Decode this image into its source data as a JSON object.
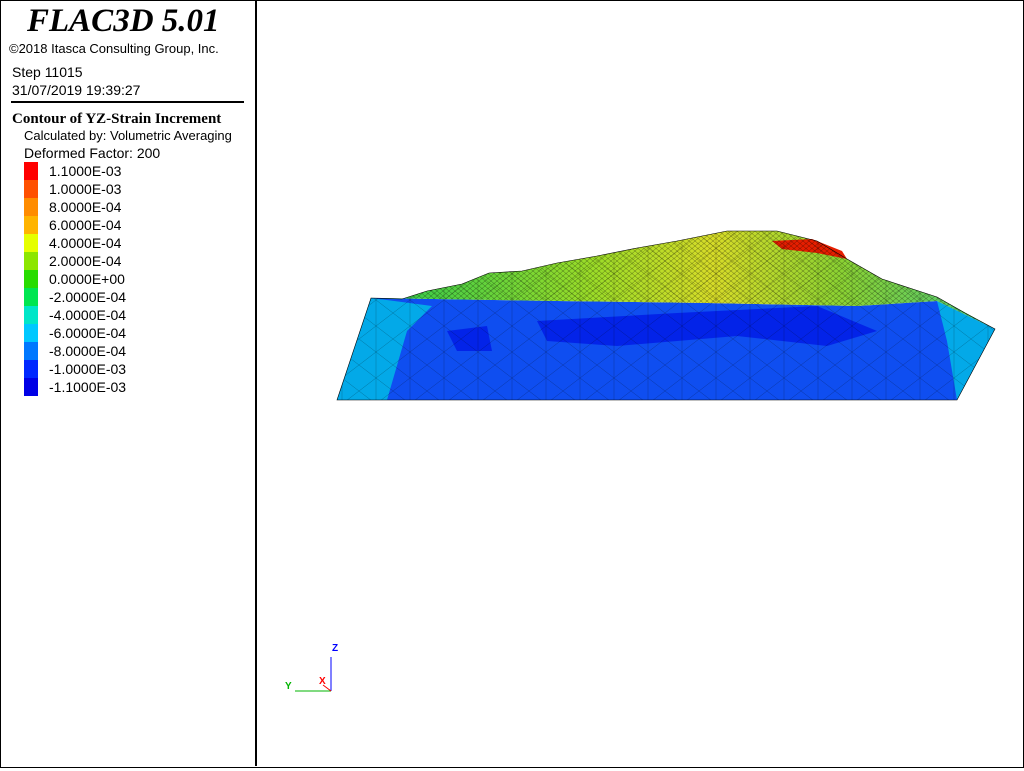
{
  "header": {
    "app_title": "FLAC3D 5.01",
    "copyright": "©2018 Itasca Consulting Group, Inc.",
    "step": "Step 11015",
    "timestamp": "31/07/2019 19:39:27"
  },
  "contour": {
    "title": "Contour of YZ-Strain Increment",
    "calculated_by": "Calculated by: Volumetric Averaging",
    "deformed_factor": "Deformed Factor: 200",
    "scale": [
      {
        "label": "1.1000E-03",
        "color": "#ff0000"
      },
      {
        "label": "1.0000E-03",
        "color": "#ff5000"
      },
      {
        "label": "8.0000E-04",
        "color": "#ff8c00"
      },
      {
        "label": "6.0000E-04",
        "color": "#ffb400"
      },
      {
        "label": "4.0000E-04",
        "color": "#e6ff00"
      },
      {
        "label": "2.0000E-04",
        "color": "#8ce600"
      },
      {
        "label": "0.0000E+00",
        "color": "#28dc00"
      },
      {
        "label": "-2.0000E-04",
        "color": "#00e650"
      },
      {
        "label": "-4.0000E-04",
        "color": "#00e6c8"
      },
      {
        "label": "-6.0000E-04",
        "color": "#00c8ff"
      },
      {
        "label": "-8.0000E-04",
        "color": "#0078ff"
      },
      {
        "label": "-1.0000E-03",
        "color": "#0028ff"
      },
      {
        "label": "-1.1000E-03",
        "color": "#0000e6"
      }
    ]
  },
  "axes": {
    "z_label": "Z",
    "y_label": "Y",
    "x_label": "X",
    "z_color": "#0000ff",
    "y_color": "#00b400",
    "x_color": "#ff0000"
  }
}
